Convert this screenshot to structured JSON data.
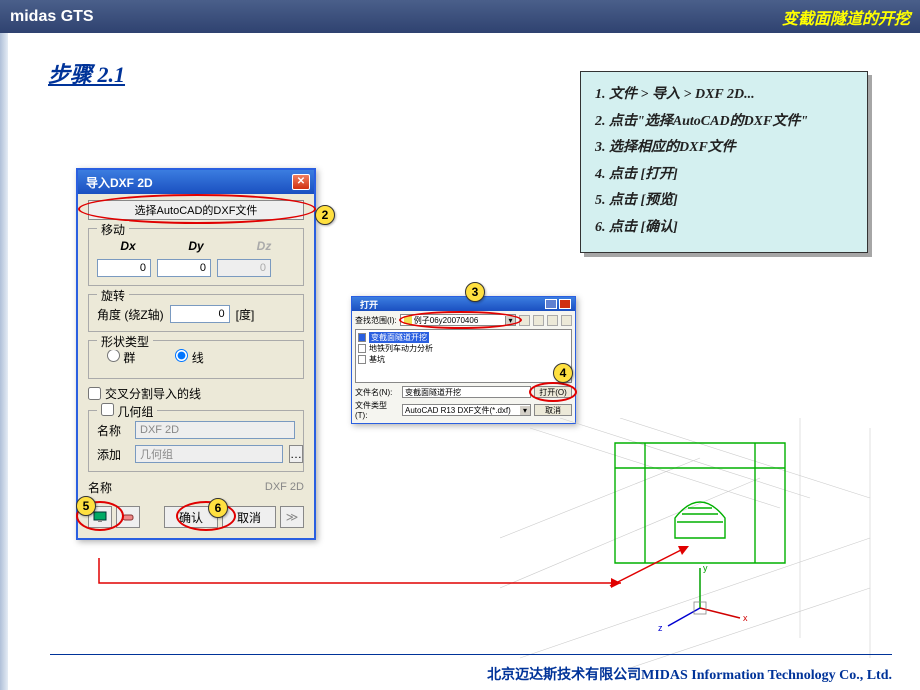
{
  "header": {
    "left": "midas GTS",
    "right": "变截面隧道的开挖"
  },
  "step_title": "步骤 2.1",
  "instructions": {
    "i1": "1. 文件 > 导入 > DXF 2D...",
    "i2": "2. 点击\"选择AutoCAD的DXF文件\"",
    "i3": "3. 选择相应的DXF文件",
    "i4": "4. 点击 [打开]",
    "i5": "5. 点击 [预览]",
    "i6": "6. 点击 [确认]"
  },
  "dlg1": {
    "title": "导入DXF 2D",
    "select_btn": "选择AutoCAD的DXF文件",
    "move": {
      "legend": "移动",
      "dx": "Dx",
      "dy": "Dy",
      "dz": "Dz",
      "v0a": "0",
      "v0b": "0",
      "v0c": "0"
    },
    "rotate": {
      "legend": "旋转",
      "label": "角度 (绕Z轴)",
      "val": "0",
      "unit": "[度]"
    },
    "shape": {
      "legend": "形状类型",
      "grp": "群",
      "line": "线"
    },
    "cross": "交叉分割导入的线",
    "geom": {
      "legend": "几何组",
      "name_lbl": "名称",
      "name_val": "DXF 2D",
      "add_lbl": "添加",
      "add_val": "几何组"
    },
    "name2_lbl": "名称",
    "name2_val": "DXF 2D",
    "ok": "确认",
    "cancel": "取消"
  },
  "dlg2": {
    "title": "打开",
    "look_lbl": "查找范围(I):",
    "folder": "例子06y20070406",
    "files": {
      "f1": "变截面隧道开挖",
      "f2": "地铁列车动力分析",
      "f3": "基坑"
    },
    "fname_lbl": "文件名(N):",
    "fname_val": "变截面隧道开挖",
    "ftype_lbl": "文件类型(T):",
    "ftype_val": "AutoCAD R13 DXF文件(*.dxf)",
    "open_btn": "打开(O)",
    "cancel_btn": "取消"
  },
  "markers": {
    "m2": "2",
    "m3": "3",
    "m4": "4",
    "m5": "5",
    "m6": "6"
  },
  "footer": "北京迈达斯技术有限公司MIDAS Information Technology Co., Ltd."
}
